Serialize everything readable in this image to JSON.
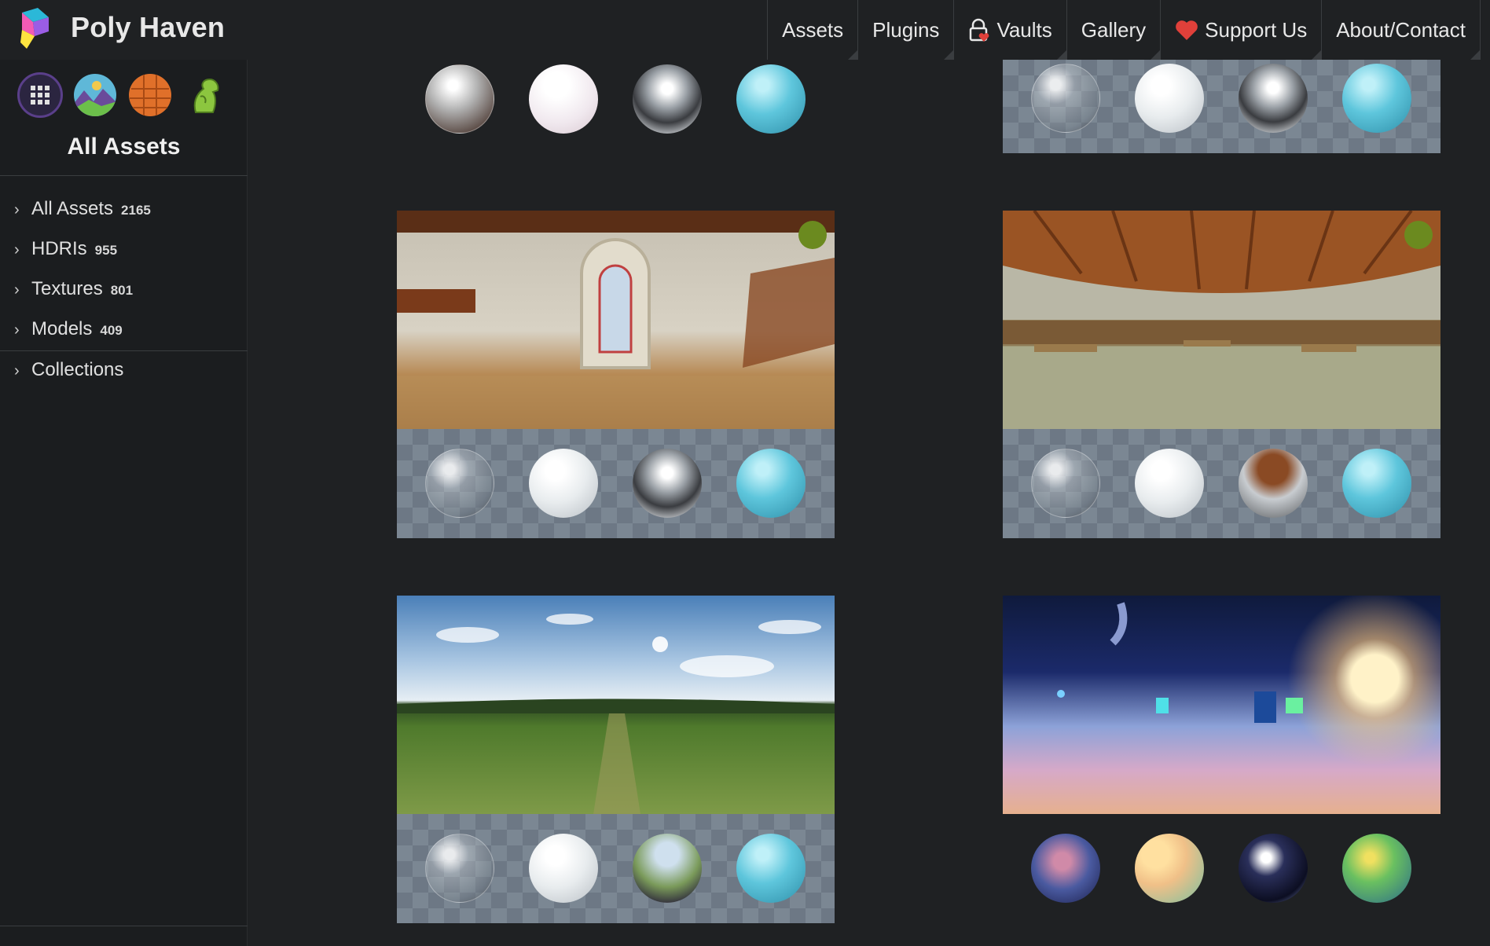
{
  "header": {
    "brand": "Poly Haven",
    "nav": [
      {
        "label": "Assets",
        "icon": ""
      },
      {
        "label": "Plugins",
        "icon": ""
      },
      {
        "label": "Vaults",
        "icon": "lock-heart-icon"
      },
      {
        "label": "Gallery",
        "icon": ""
      },
      {
        "label": "Support Us",
        "icon": "heart-icon"
      },
      {
        "label": "About/Contact",
        "icon": ""
      }
    ]
  },
  "sidebar": {
    "type_icons": [
      "all-assets-grid-icon",
      "hdri-icon",
      "texture-icon",
      "model-icon"
    ],
    "title": "All Assets",
    "items": [
      {
        "label": "All Assets",
        "count": "2165"
      },
      {
        "label": "HDRIs",
        "count": "955"
      },
      {
        "label": "Textures",
        "count": "801"
      },
      {
        "label": "Models",
        "count": "409"
      }
    ],
    "collections": "Collections"
  },
  "colors": {
    "background": "#1f2123",
    "sidebar": "#1b1d1f",
    "accent_purple": "#5a3f8a",
    "new_dot": "#6b8a1f",
    "heart": "#e0403a"
  }
}
